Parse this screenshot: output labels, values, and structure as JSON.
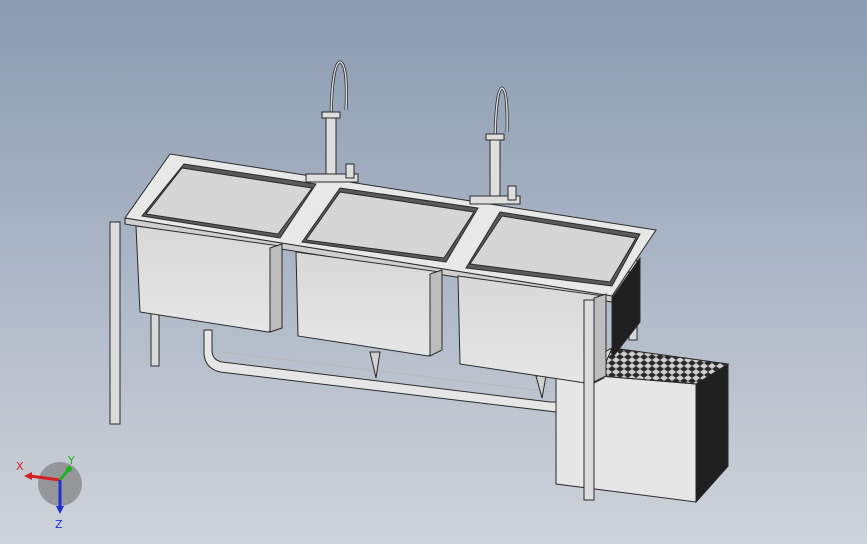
{
  "viewport": {
    "background_top": "#8b9bb1",
    "background_bottom": "#cfd3da"
  },
  "model": {
    "description_icon": "three-compartment-sink-model",
    "colors": {
      "steel_light": "#e9e9e9",
      "steel_mid": "#cfcfcf",
      "steel_dark": "#9e9e9e",
      "outline": "#2a2a2a"
    }
  },
  "triad": {
    "x_label": "X",
    "y_label": "Y",
    "z_label": "Z",
    "x_color": "#d42020",
    "y_color": "#20b020",
    "z_color": "#2030d0"
  }
}
